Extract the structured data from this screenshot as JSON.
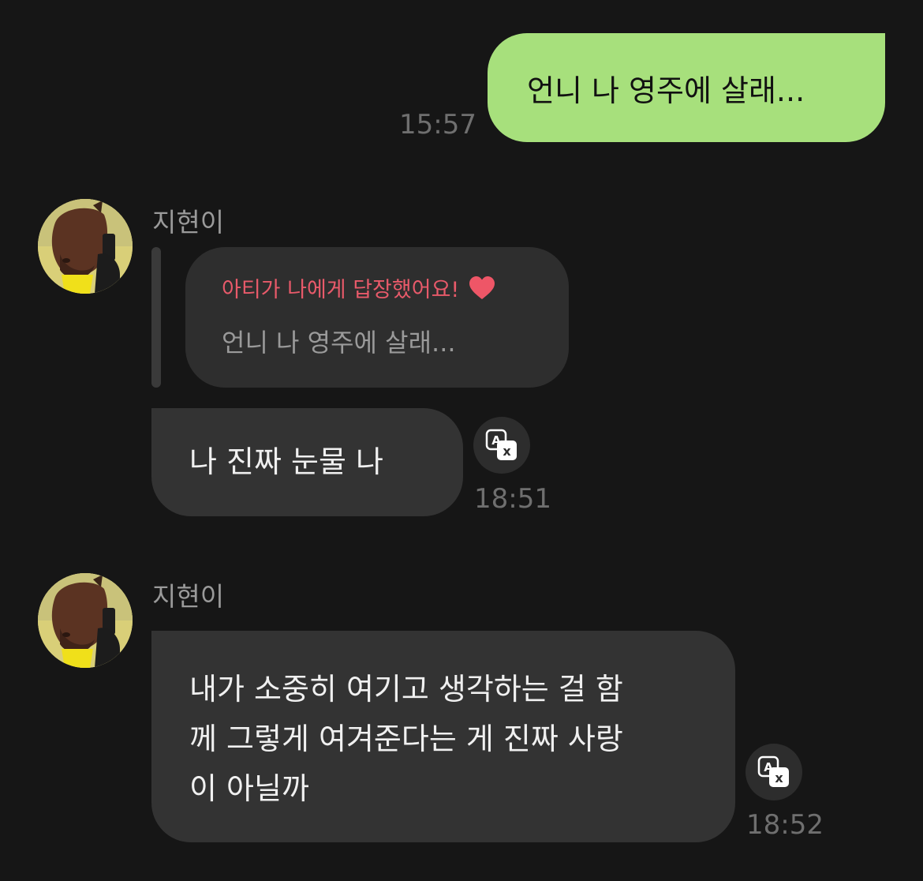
{
  "messages": [
    {
      "id": "m1",
      "direction": "outgoing",
      "text": "언니 나 영주에 살래...",
      "time": "15:57"
    },
    {
      "id": "m2",
      "direction": "incoming",
      "sender": "지현이",
      "reply": {
        "header": "아티가 나에게 답장했어요!",
        "quoted_text": "언니 나 영주에 살래..."
      },
      "text": "나 진짜 눈물 나",
      "time": "18:51"
    },
    {
      "id": "m3",
      "direction": "incoming",
      "sender": "지현이",
      "lines": [
        "내가 소중히 여기고 생각하는 걸 함",
        "께 그렇게 여겨준다는 게 진짜 사랑",
        "이 아닐까"
      ],
      "time": "18:52"
    }
  ],
  "icons": {
    "reply_heart": "heart-icon",
    "translate": "translate-icon",
    "avatar": "horse-mask-avatar"
  },
  "colors": {
    "background": "#161616",
    "outgoing_bubble": "#a7e07c",
    "incoming_bubble": "#333333",
    "reply_header": "#e85a6a",
    "timestamp": "#6f6f6f"
  }
}
